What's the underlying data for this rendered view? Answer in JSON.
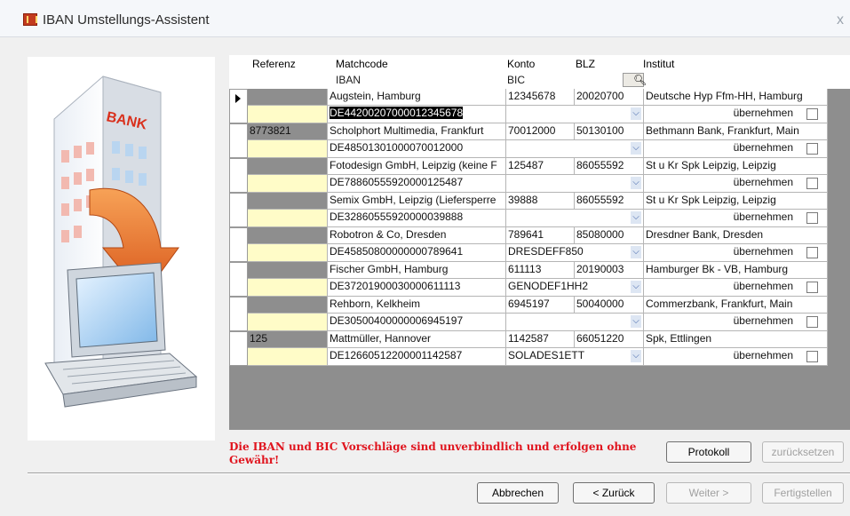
{
  "window": {
    "title": "IBAN Umstellungs-Assistent",
    "close_glyph": "x"
  },
  "grid": {
    "headers": {
      "referenz": "Referenz",
      "matchcode": "Matchcode",
      "iban": "IBAN",
      "konto": "Konto",
      "bic": "BIC",
      "blz": "BLZ",
      "institut": "Institut",
      "lookup_icon": "magnifier-icon"
    },
    "rows": [
      {
        "referenz": "",
        "matchcode": "Augstein, Hamburg",
        "konto": "12345678",
        "blz": "20020700",
        "institut": "Deutsche Hyp Ffm-HH, Hamburg",
        "iban": "DE44200207000012345678",
        "bic": "",
        "action": "übernehmen",
        "current": true
      },
      {
        "referenz": "8773821",
        "matchcode": "Scholphort Multimedia, Frankfurt",
        "konto": "70012000",
        "blz": "50130100",
        "institut": "Bethmann Bank, Frankfurt, Main",
        "iban": "DE48501301000070012000",
        "bic": "",
        "action": "übernehmen",
        "current": false
      },
      {
        "referenz": "",
        "matchcode": "Fotodesign GmbH, Leipzig (keine F",
        "konto": "125487",
        "blz": "86055592",
        "institut": "St u Kr Spk Leipzig, Leipzig",
        "iban": "DE78860555920000125487",
        "bic": "",
        "action": "übernehmen",
        "current": false
      },
      {
        "referenz": "",
        "matchcode": "Semix GmbH, Leipzig (Liefersperre",
        "konto": "39888",
        "blz": "86055592",
        "institut": "St u Kr Spk Leipzig, Leipzig",
        "iban": "DE32860555920000039888",
        "bic": "",
        "action": "übernehmen",
        "current": false
      },
      {
        "referenz": "",
        "matchcode": "Robotron & Co, Dresden",
        "konto": "789641",
        "blz": "85080000",
        "institut": "Dresdner Bank, Dresden",
        "iban": "DE45850800000000789641",
        "bic": "DRESDEFF850",
        "action": "übernehmen",
        "current": false
      },
      {
        "referenz": "",
        "matchcode": "Fischer GmbH, Hamburg",
        "konto": "611113",
        "blz": "20190003",
        "institut": "Hamburger Bk - VB, Hamburg",
        "iban": "DE37201900030000611113",
        "bic": "GENODEF1HH2",
        "action": "übernehmen",
        "current": false
      },
      {
        "referenz": "",
        "matchcode": "Rehborn, Kelkheim",
        "konto": "6945197",
        "blz": "50040000",
        "institut": "Commerzbank, Frankfurt, Main",
        "iban": "DE30500400000006945197",
        "bic": "",
        "action": "übernehmen",
        "current": false
      },
      {
        "referenz": "125",
        "matchcode": "Mattmüller, Hannover",
        "konto": "1142587",
        "blz": "66051220",
        "institut": "Spk, Ettlingen",
        "iban": "DE12660512200001142587",
        "bic": "SOLADES1ETT",
        "action": "übernehmen",
        "current": false
      }
    ]
  },
  "illustration": {
    "sign_text": "BANK",
    "icons": [
      "bank-building-icon",
      "laptop-icon",
      "arrow-down-icon"
    ]
  },
  "warning": "Die IBAN und BIC Vorschläge sind unverbindlich und erfolgen ohne Gewähr!",
  "buttons": {
    "protokoll": "Protokoll",
    "zuruecksetzen": "zurücksetzen",
    "abbrechen": "Abbrechen",
    "zurueck": "< Zurück",
    "weiter": "Weiter >",
    "fertigstellen": "Fertigstellen"
  },
  "colors": {
    "warning": "#e0141e",
    "referenz_fill": "#fffcc8",
    "grid_empty": "#8e8e8e"
  }
}
